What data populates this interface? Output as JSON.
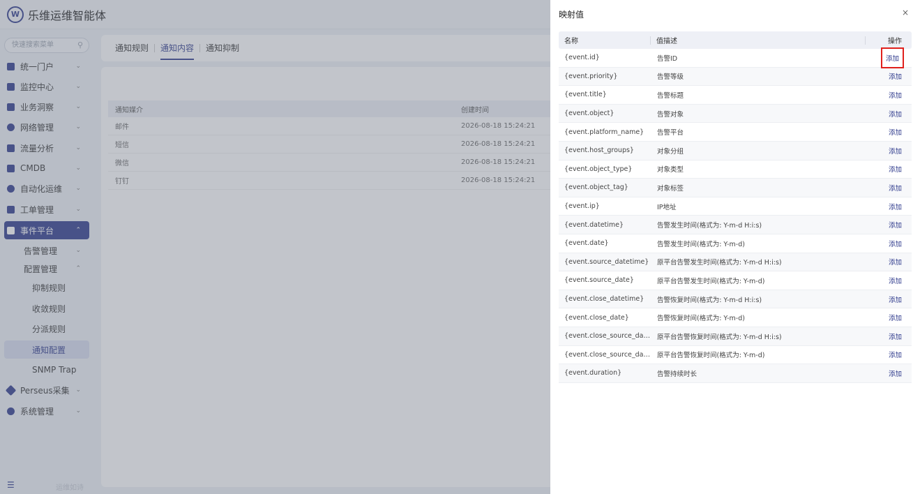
{
  "app": {
    "title": "乐维运维智能体",
    "logo_text": "W"
  },
  "sidebar": {
    "search_placeholder": "快速搜索菜单",
    "menu": [
      {
        "label": "统一门户"
      },
      {
        "label": "监控中心"
      },
      {
        "label": "业务洞察"
      },
      {
        "label": "网络管理"
      },
      {
        "label": "流量分析"
      },
      {
        "label": "CMDB"
      },
      {
        "label": "自动化运维"
      },
      {
        "label": "工单管理"
      },
      {
        "label": "事件平台"
      }
    ],
    "sub": [
      {
        "label": "告警管理"
      },
      {
        "label": "配置管理"
      }
    ],
    "leaves": [
      {
        "label": "抑制规则"
      },
      {
        "label": "收敛规则"
      },
      {
        "label": "分派规则"
      },
      {
        "label": "通知配置"
      },
      {
        "label": "SNMP Trap"
      }
    ],
    "menu_after": [
      {
        "label": "Perseus采集"
      },
      {
        "label": "系统管理"
      }
    ],
    "footer_text": "运维如诗"
  },
  "main": {
    "tabs": [
      {
        "label": "通知规则"
      },
      {
        "label": "通知内容"
      },
      {
        "label": "通知抑制"
      }
    ],
    "table": {
      "headers": [
        "通知媒介",
        "创建时间"
      ],
      "rows": [
        [
          "邮件",
          "2026-08-18 15:24:21"
        ],
        [
          "短信",
          "2026-08-18 15:24:21"
        ],
        [
          "微信",
          "2026-08-18 15:24:21"
        ],
        [
          "钉钉",
          "2026-08-18 15:24:21"
        ]
      ]
    }
  },
  "drawer": {
    "title": "映射值",
    "close": "×",
    "headers": {
      "name": "名称",
      "desc": "值描述",
      "action": "操作"
    },
    "action_label": "添加",
    "rows": [
      {
        "name": "{event.id}",
        "desc": "告警ID"
      },
      {
        "name": "{event.priority}",
        "desc": "告警等级"
      },
      {
        "name": "{event.title}",
        "desc": "告警标题"
      },
      {
        "name": "{event.object}",
        "desc": "告警对象"
      },
      {
        "name": "{event.platform_name}",
        "desc": "告警平台"
      },
      {
        "name": "{event.host_groups}",
        "desc": "对象分组"
      },
      {
        "name": "{event.object_type}",
        "desc": "对象类型"
      },
      {
        "name": "{event.object_tag}",
        "desc": "对象标签"
      },
      {
        "name": "{event.ip}",
        "desc": "IP地址"
      },
      {
        "name": "{event.datetime}",
        "desc": "告警发生时间(格式为: Y-m-d H:i:s)"
      },
      {
        "name": "{event.date}",
        "desc": "告警发生时间(格式为: Y-m-d)"
      },
      {
        "name": "{event.source_datetime}",
        "desc": "原平台告警发生时间(格式为: Y-m-d H:i:s)"
      },
      {
        "name": "{event.source_date}",
        "desc": "原平台告警发生时间(格式为: Y-m-d)"
      },
      {
        "name": "{event.close_datetime}",
        "desc": "告警恢复时间(格式为: Y-m-d H:i:s)"
      },
      {
        "name": "{event.close_date}",
        "desc": "告警恢复时间(格式为: Y-m-d)"
      },
      {
        "name": "{event.close_source_date...",
        "desc": "原平台告警恢复时间(格式为: Y-m-d H:i:s)"
      },
      {
        "name": "{event.close_source_date}",
        "desc": "原平台告警恢复时间(格式为: Y-m-d)"
      },
      {
        "name": "{event.duration}",
        "desc": "告警持续时长"
      }
    ]
  }
}
